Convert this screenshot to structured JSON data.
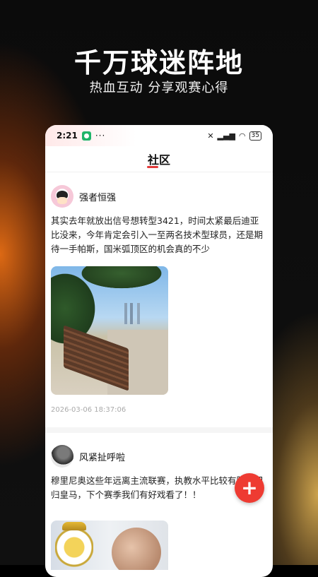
{
  "promo": {
    "title": "千万球迷阵地",
    "subtitle": "热血互动 分享观赛心得"
  },
  "statusbar": {
    "time": "2:21",
    "dots": "···",
    "battery": "35"
  },
  "nav": {
    "title": "社区"
  },
  "posts": [
    {
      "author": "强者恒强",
      "content": "其实去年就放出信号想转型3421，时间太紧最后迪亚比没来，今年肯定会引入一至两名技术型球员，还是期待一手帕斯，国米弧顶区的机会真的不少",
      "timestamp": "2026-03-06 18:37:06"
    },
    {
      "author": "风紧扯呼啦",
      "content": "穆里尼奥这些年远离主流联赛，执教水平比较有限，回归皇马，下个赛季我们有好戏看了！！"
    }
  ],
  "fab": {
    "label": "+"
  },
  "colors": {
    "accent": "#ee3b32",
    "underline": "#e23a3a"
  }
}
